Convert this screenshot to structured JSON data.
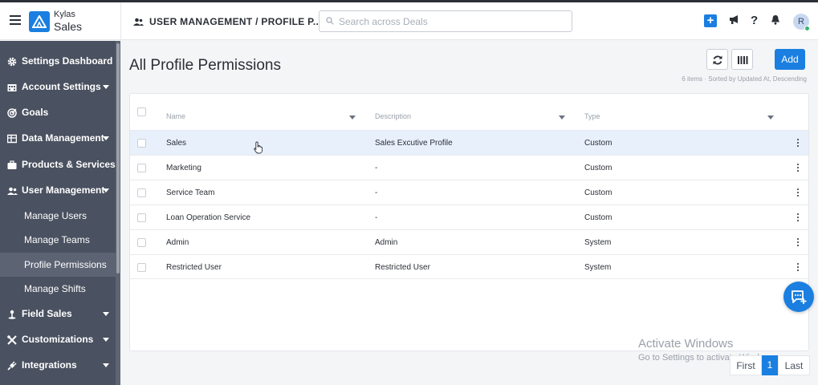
{
  "app": {
    "brand_top": "Kylas",
    "brand_main": "Sales"
  },
  "header": {
    "breadcrumb": "USER MANAGEMENT / PROFILE P...",
    "search_placeholder": "Search across Deals",
    "avatar_initial": "R",
    "help_label": "?",
    "add_label": "+"
  },
  "sidebar": {
    "items": [
      {
        "label": "Settings Dashboard",
        "icon": "gear-icon",
        "has_caret": false
      },
      {
        "label": "Account Settings",
        "icon": "building-icon",
        "has_caret": true
      },
      {
        "label": "Goals",
        "icon": "target-icon",
        "has_caret": false
      },
      {
        "label": "Data Management",
        "icon": "table-icon",
        "has_caret": true
      },
      {
        "label": "Products & Services",
        "icon": "briefcase-icon",
        "has_caret": false
      },
      {
        "label": "User Management",
        "icon": "users-icon",
        "has_caret": true
      },
      {
        "label": "Field Sales",
        "icon": "pin-icon",
        "has_caret": true
      },
      {
        "label": "Customizations",
        "icon": "tools-icon",
        "has_caret": true
      },
      {
        "label": "Integrations",
        "icon": "plug-icon",
        "has_caret": true
      }
    ],
    "user_management_sub": [
      {
        "label": "Manage Users",
        "active": false
      },
      {
        "label": "Manage Teams",
        "active": false
      },
      {
        "label": "Profile Permissions",
        "active": true
      },
      {
        "label": "Manage Shifts",
        "active": false
      }
    ]
  },
  "main": {
    "title": "All Profile Permissions",
    "add_label": "Add",
    "sort_info": "6 items · Sorted by Updated At, Descending",
    "columns": [
      "Name",
      "Description",
      "Type"
    ],
    "rows": [
      {
        "name": "Sales",
        "description": "Sales Excutive Profile",
        "type": "Custom",
        "highlighted": true
      },
      {
        "name": "Marketing",
        "description": "-",
        "type": "Custom",
        "highlighted": false
      },
      {
        "name": "Service Team",
        "description": "-",
        "type": "Custom",
        "highlighted": false
      },
      {
        "name": "Loan Operation Service",
        "description": "-",
        "type": "Custom",
        "highlighted": false
      },
      {
        "name": "Admin",
        "description": "Admin",
        "type": "System",
        "highlighted": false
      },
      {
        "name": "Restricted User",
        "description": "Restricted User",
        "type": "System",
        "highlighted": false
      }
    ]
  },
  "pagination": {
    "first": "First",
    "current": "1",
    "last": "Last"
  },
  "watermark": {
    "line1": "Activate Windows",
    "line2": "Go to Settings to activate Windows."
  },
  "colors": {
    "accent": "#1a7fe0",
    "sidebar_bg": "#4a5160",
    "row_highlight": "#e8f0fc"
  }
}
